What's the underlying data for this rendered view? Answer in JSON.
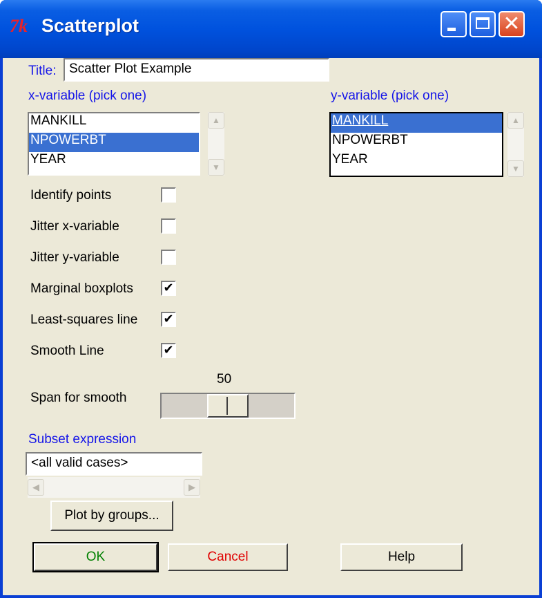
{
  "window": {
    "title": "Scatterplot",
    "icon": "tk-feather-icon"
  },
  "title_field": {
    "label": "Title:",
    "value": "Scatter Plot Example"
  },
  "x_variable": {
    "label": "x-variable (pick one)",
    "items": [
      {
        "label": "MANKILL",
        "selected": false
      },
      {
        "label": "NPOWERBT",
        "selected": true
      },
      {
        "label": "YEAR",
        "selected": false
      }
    ]
  },
  "y_variable": {
    "label": "y-variable (pick one)",
    "items": [
      {
        "label": "MANKILL",
        "selected": true
      },
      {
        "label": "NPOWERBT",
        "selected": false
      },
      {
        "label": "YEAR",
        "selected": false
      }
    ]
  },
  "options": [
    {
      "label": "Identify points",
      "checked": false
    },
    {
      "label": "Jitter x-variable",
      "checked": false
    },
    {
      "label": "Jitter y-variable",
      "checked": false
    },
    {
      "label": "Marginal boxplots",
      "checked": true
    },
    {
      "label": "Least-squares line",
      "checked": true
    },
    {
      "label": "Smooth Line",
      "checked": true
    }
  ],
  "span": {
    "label": "Span for smooth",
    "value": "50"
  },
  "subset": {
    "label": "Subset expression",
    "value": "<all valid cases>"
  },
  "buttons": {
    "plot_by_groups": "Plot by groups...",
    "ok": "OK",
    "cancel": "Cancel",
    "help": "Help"
  },
  "colors": {
    "label_accent": "#1515e8",
    "ok_text": "#008000",
    "cancel_text": "#e00000",
    "selection": "#3a70d1",
    "titlebar": "#0052de"
  }
}
